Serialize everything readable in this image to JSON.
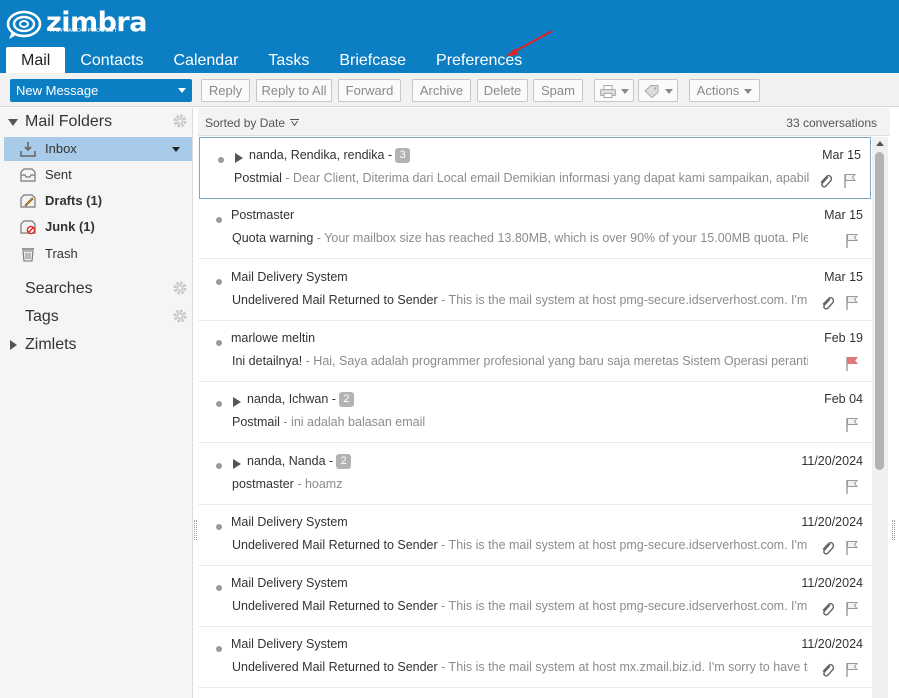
{
  "app": {
    "logo_text": "zimbra",
    "logo_sub": "A SYNACOR PRODUCT"
  },
  "tabs": [
    {
      "label": "Mail"
    },
    {
      "label": "Contacts"
    },
    {
      "label": "Calendar"
    },
    {
      "label": "Tasks"
    },
    {
      "label": "Briefcase"
    },
    {
      "label": "Preferences"
    }
  ],
  "toolbar": {
    "new_message": "New Message",
    "reply": "Reply",
    "reply_all": "Reply to All",
    "forward": "Forward",
    "archive": "Archive",
    "delete": "Delete",
    "spam": "Spam",
    "actions": "Actions"
  },
  "sidebar": {
    "mail_folders": "Mail Folders",
    "folders": [
      {
        "label": "Inbox",
        "icon": "inbox-icon"
      },
      {
        "label": "Sent",
        "icon": "sent-icon"
      },
      {
        "label": "Drafts (1)",
        "icon": "drafts-icon"
      },
      {
        "label": "Junk (1)",
        "icon": "junk-icon"
      },
      {
        "label": "Trash",
        "icon": "trash-icon"
      }
    ],
    "searches": "Searches",
    "tags": "Tags",
    "zimlets": "Zimlets"
  },
  "list": {
    "sort_label": "Sorted by Date",
    "count": "33 conversations",
    "rows": [
      {
        "sender": "nanda, Rendika, rendika -",
        "badge": "3",
        "date": "Mar 15",
        "subject": "Postmial",
        "fragment": " - Dear Client, Diterima dari Local email Demikian informasi yang dapat kami sampaikan, apabila ada"
      },
      {
        "sender": "Postmaster",
        "badge": "",
        "date": "Mar 15",
        "subject": "Quota warning",
        "fragment": " - Your mailbox size has reached 13.80MB, which is over 90% of your 15.00MB quota. Please delete s"
      },
      {
        "sender": "Mail Delivery System",
        "badge": "",
        "date": "Mar 15",
        "subject": "Undelivered Mail Returned to Sender",
        "fragment": " - This is the mail system at host pmg-secure.idserverhost.com. I'm sorry"
      },
      {
        "sender": "marlowe meltin",
        "badge": "",
        "date": "Feb 19",
        "subject": "Ini detailnya!",
        "fragment": " - Hai, Saya adalah programmer profesional yang baru saja meretas Sistem Operasi peranti Anda. &nb"
      },
      {
        "sender": "nanda, Ichwan -",
        "badge": "2",
        "date": "Feb 04",
        "subject": "Postmail",
        "fragment": " - ini adalah balasan email"
      },
      {
        "sender": "nanda, Nanda -",
        "badge": "2",
        "date": "11/20/2024",
        "subject": "postmaster",
        "fragment": " - hoamz"
      },
      {
        "sender": "Mail Delivery System",
        "badge": "",
        "date": "11/20/2024",
        "subject": "Undelivered Mail Returned to Sender",
        "fragment": " - This is the mail system at host pmg-secure.idserverhost.com. I'm sorry"
      },
      {
        "sender": "Mail Delivery System",
        "badge": "",
        "date": "11/20/2024",
        "subject": "Undelivered Mail Returned to Sender",
        "fragment": " - This is the mail system at host pmg-secure.idserverhost.com. I'm sorry"
      },
      {
        "sender": "Mail Delivery System",
        "badge": "",
        "date": "11/20/2024",
        "subject": "Undelivered Mail Returned to Sender",
        "fragment": " - This is the mail system at host mx.zmail.biz.id. I'm sorry to have to info"
      }
    ]
  },
  "colors": {
    "brand": "#0c7fc4",
    "selected_folder": "#a7cbe8",
    "flag_red": "#e07a7a",
    "annotation_arrow": "#e02020"
  }
}
